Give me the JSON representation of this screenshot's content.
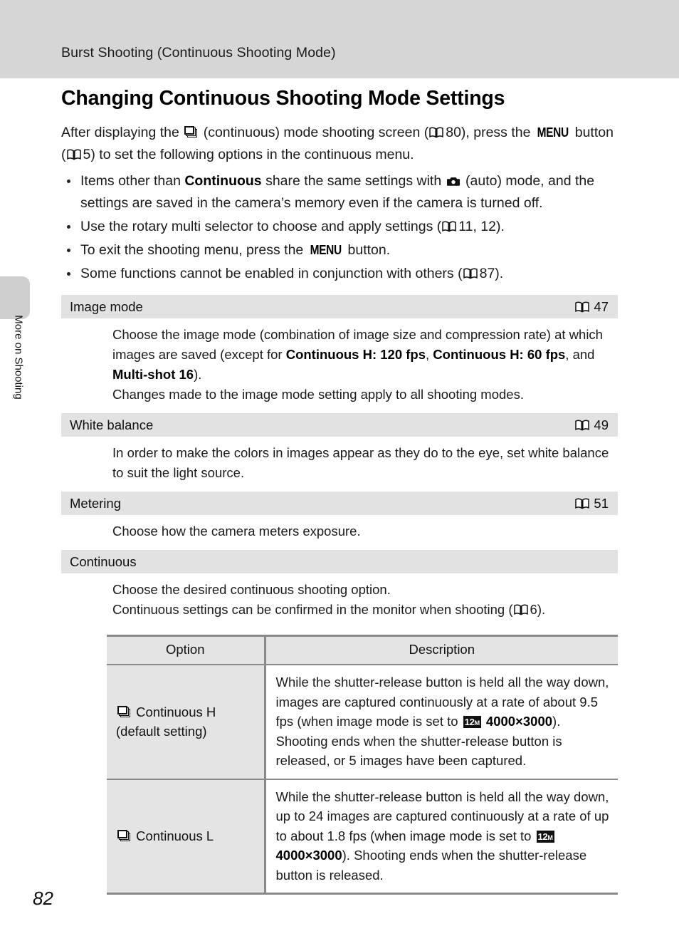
{
  "header": {
    "running_title": "Burst Shooting (Continuous Shooting Mode)"
  },
  "side_tab": {
    "label": "More on Shooting"
  },
  "page_number": "82",
  "main": {
    "title": "Changing Continuous Shooting Mode Settings",
    "intro": {
      "part1": "After displaying the",
      "part2": "(continuous) mode shooting screen (",
      "ref1_page": "80",
      "part3": "), press the",
      "menu_label": "MENU",
      "part4": "button (",
      "ref2_page": "5",
      "part5": ") to set the following options in the continuous menu."
    },
    "bullets": [
      {
        "b1_a": "Items other than",
        "b1_bold": "Continuous",
        "b1_b": "share the same settings with",
        "b1_c": "(auto) mode, and the settings are saved in the camera’s memory even if the camera is turned off."
      },
      {
        "b2_a": "Use the rotary multi selector to choose and apply settings (",
        "b2_ref": "11, 12",
        "b2_b": ")."
      },
      {
        "b3_a": "To exit the shooting menu, press the",
        "b3_menu": "MENU",
        "b3_b": "button."
      },
      {
        "b4_a": "Some functions cannot be enabled in conjunction with others (",
        "b4_ref": "87",
        "b4_b": ")."
      }
    ]
  },
  "settings": [
    {
      "name": "Image mode",
      "ref_page": "47",
      "body": {
        "l1_a": "Choose the image mode (combination of image size and compression rate) at which images are saved (except for",
        "l1_bold1": "Continuous H: 120 fps",
        "l1_sep1": ",",
        "l1_bold2": "Continuous H: 60 fps",
        "l1_sep2": ", and",
        "l1_bold3": "Multi-shot 16",
        "l1_b": ").",
        "l2": "Changes made to the image mode setting apply to all shooting modes."
      }
    },
    {
      "name": "White balance",
      "ref_page": "49",
      "body": {
        "l1": "In order to make the colors in images appear as they do to the eye, set white balance to suit the light source."
      }
    },
    {
      "name": "Metering",
      "ref_page": "51",
      "body": {
        "l1": "Choose how the camera meters exposure."
      }
    },
    {
      "name": "Continuous",
      "ref_page": "",
      "body": {
        "l1": "Choose the desired continuous shooting option.",
        "l2_a": "Continuous settings can be confirmed in the monitor when shooting (",
        "l2_ref": "6",
        "l2_b": ")."
      }
    }
  ],
  "options_table": {
    "columns": [
      "Option",
      "Description"
    ],
    "rows": [
      {
        "option_line1": "Continuous H",
        "option_line2": "(default setting)",
        "desc_a": "While the shutter-release button is held all the way down, images are captured continuously at a rate of about 9.5 fps (when image mode is set to",
        "desc_badge": "12",
        "desc_badge_sub": "M",
        "desc_bold": "4000×3000",
        "desc_b": "). Shooting ends when the shutter-release button is released, or 5 images have been captured."
      },
      {
        "option_line1": "Continuous L",
        "option_line2": "",
        "desc_a": "While the shutter-release button is held all the way down, up to 24 images are captured continuously at a rate of up to about 1.8 fps (when image mode is set to",
        "desc_badge": "12",
        "desc_badge_sub": "M",
        "desc_bold": "4000×3000",
        "desc_b": "). Shooting ends when the shutter-release button is released."
      }
    ]
  },
  "colors": {
    "header_band": "#d6d6d6",
    "section_band": "#e2e2e2",
    "table_cell": "#e4e4e4",
    "table_border": "#8a8a8a"
  }
}
